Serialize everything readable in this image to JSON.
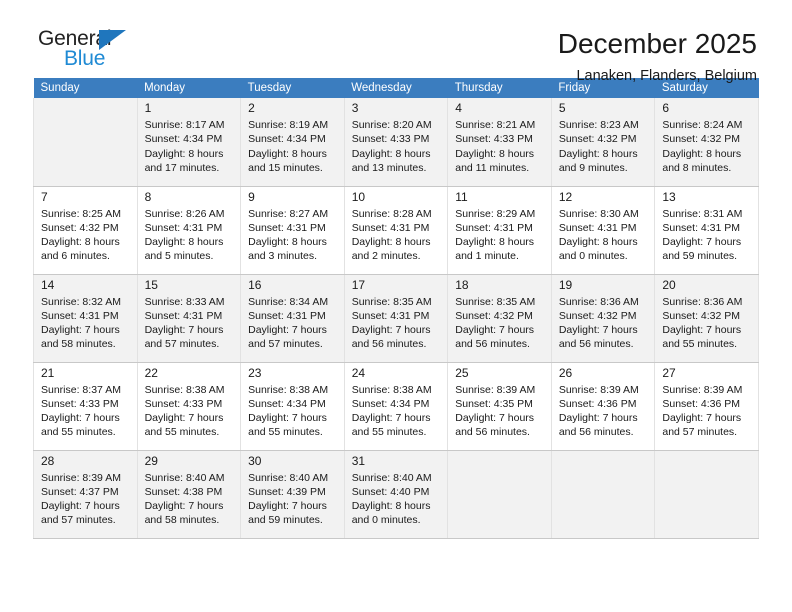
{
  "brand": {
    "name_top": "General",
    "name_bottom": "Blue",
    "triangle_color": "#1f76bd",
    "bottom_color": "#1f8ad4"
  },
  "header": {
    "month_title": "December 2025",
    "location": "Lanaken, Flanders, Belgium"
  },
  "colors": {
    "header_row_bg": "#3b7dbf",
    "header_row_text": "#ffffff",
    "shaded_row_bg": "#f2f2f2",
    "plain_row_bg": "#ffffff",
    "cell_border": "#c8c8c8"
  },
  "weekday_headers": [
    "Sunday",
    "Monday",
    "Tuesday",
    "Wednesday",
    "Thursday",
    "Friday",
    "Saturday"
  ],
  "weeks": [
    {
      "shaded": true,
      "days": [
        {
          "num": "",
          "sunrise": "",
          "sunset": "",
          "daylight1": "",
          "daylight2": "",
          "empty": true
        },
        {
          "num": "1",
          "sunrise": "Sunrise: 8:17 AM",
          "sunset": "Sunset: 4:34 PM",
          "daylight1": "Daylight: 8 hours",
          "daylight2": "and 17 minutes.",
          "empty": false
        },
        {
          "num": "2",
          "sunrise": "Sunrise: 8:19 AM",
          "sunset": "Sunset: 4:34 PM",
          "daylight1": "Daylight: 8 hours",
          "daylight2": "and 15 minutes.",
          "empty": false
        },
        {
          "num": "3",
          "sunrise": "Sunrise: 8:20 AM",
          "sunset": "Sunset: 4:33 PM",
          "daylight1": "Daylight: 8 hours",
          "daylight2": "and 13 minutes.",
          "empty": false
        },
        {
          "num": "4",
          "sunrise": "Sunrise: 8:21 AM",
          "sunset": "Sunset: 4:33 PM",
          "daylight1": "Daylight: 8 hours",
          "daylight2": "and 11 minutes.",
          "empty": false
        },
        {
          "num": "5",
          "sunrise": "Sunrise: 8:23 AM",
          "sunset": "Sunset: 4:32 PM",
          "daylight1": "Daylight: 8 hours",
          "daylight2": "and 9 minutes.",
          "empty": false
        },
        {
          "num": "6",
          "sunrise": "Sunrise: 8:24 AM",
          "sunset": "Sunset: 4:32 PM",
          "daylight1": "Daylight: 8 hours",
          "daylight2": "and 8 minutes.",
          "empty": false
        }
      ]
    },
    {
      "shaded": false,
      "days": [
        {
          "num": "7",
          "sunrise": "Sunrise: 8:25 AM",
          "sunset": "Sunset: 4:32 PM",
          "daylight1": "Daylight: 8 hours",
          "daylight2": "and 6 minutes.",
          "empty": false
        },
        {
          "num": "8",
          "sunrise": "Sunrise: 8:26 AM",
          "sunset": "Sunset: 4:31 PM",
          "daylight1": "Daylight: 8 hours",
          "daylight2": "and 5 minutes.",
          "empty": false
        },
        {
          "num": "9",
          "sunrise": "Sunrise: 8:27 AM",
          "sunset": "Sunset: 4:31 PM",
          "daylight1": "Daylight: 8 hours",
          "daylight2": "and 3 minutes.",
          "empty": false
        },
        {
          "num": "10",
          "sunrise": "Sunrise: 8:28 AM",
          "sunset": "Sunset: 4:31 PM",
          "daylight1": "Daylight: 8 hours",
          "daylight2": "and 2 minutes.",
          "empty": false
        },
        {
          "num": "11",
          "sunrise": "Sunrise: 8:29 AM",
          "sunset": "Sunset: 4:31 PM",
          "daylight1": "Daylight: 8 hours",
          "daylight2": "and 1 minute.",
          "empty": false
        },
        {
          "num": "12",
          "sunrise": "Sunrise: 8:30 AM",
          "sunset": "Sunset: 4:31 PM",
          "daylight1": "Daylight: 8 hours",
          "daylight2": "and 0 minutes.",
          "empty": false
        },
        {
          "num": "13",
          "sunrise": "Sunrise: 8:31 AM",
          "sunset": "Sunset: 4:31 PM",
          "daylight1": "Daylight: 7 hours",
          "daylight2": "and 59 minutes.",
          "empty": false
        }
      ]
    },
    {
      "shaded": true,
      "days": [
        {
          "num": "14",
          "sunrise": "Sunrise: 8:32 AM",
          "sunset": "Sunset: 4:31 PM",
          "daylight1": "Daylight: 7 hours",
          "daylight2": "and 58 minutes.",
          "empty": false
        },
        {
          "num": "15",
          "sunrise": "Sunrise: 8:33 AM",
          "sunset": "Sunset: 4:31 PM",
          "daylight1": "Daylight: 7 hours",
          "daylight2": "and 57 minutes.",
          "empty": false
        },
        {
          "num": "16",
          "sunrise": "Sunrise: 8:34 AM",
          "sunset": "Sunset: 4:31 PM",
          "daylight1": "Daylight: 7 hours",
          "daylight2": "and 57 minutes.",
          "empty": false
        },
        {
          "num": "17",
          "sunrise": "Sunrise: 8:35 AM",
          "sunset": "Sunset: 4:31 PM",
          "daylight1": "Daylight: 7 hours",
          "daylight2": "and 56 minutes.",
          "empty": false
        },
        {
          "num": "18",
          "sunrise": "Sunrise: 8:35 AM",
          "sunset": "Sunset: 4:32 PM",
          "daylight1": "Daylight: 7 hours",
          "daylight2": "and 56 minutes.",
          "empty": false
        },
        {
          "num": "19",
          "sunrise": "Sunrise: 8:36 AM",
          "sunset": "Sunset: 4:32 PM",
          "daylight1": "Daylight: 7 hours",
          "daylight2": "and 56 minutes.",
          "empty": false
        },
        {
          "num": "20",
          "sunrise": "Sunrise: 8:36 AM",
          "sunset": "Sunset: 4:32 PM",
          "daylight1": "Daylight: 7 hours",
          "daylight2": "and 55 minutes.",
          "empty": false
        }
      ]
    },
    {
      "shaded": false,
      "days": [
        {
          "num": "21",
          "sunrise": "Sunrise: 8:37 AM",
          "sunset": "Sunset: 4:33 PM",
          "daylight1": "Daylight: 7 hours",
          "daylight2": "and 55 minutes.",
          "empty": false
        },
        {
          "num": "22",
          "sunrise": "Sunrise: 8:38 AM",
          "sunset": "Sunset: 4:33 PM",
          "daylight1": "Daylight: 7 hours",
          "daylight2": "and 55 minutes.",
          "empty": false
        },
        {
          "num": "23",
          "sunrise": "Sunrise: 8:38 AM",
          "sunset": "Sunset: 4:34 PM",
          "daylight1": "Daylight: 7 hours",
          "daylight2": "and 55 minutes.",
          "empty": false
        },
        {
          "num": "24",
          "sunrise": "Sunrise: 8:38 AM",
          "sunset": "Sunset: 4:34 PM",
          "daylight1": "Daylight: 7 hours",
          "daylight2": "and 55 minutes.",
          "empty": false
        },
        {
          "num": "25",
          "sunrise": "Sunrise: 8:39 AM",
          "sunset": "Sunset: 4:35 PM",
          "daylight1": "Daylight: 7 hours",
          "daylight2": "and 56 minutes.",
          "empty": false
        },
        {
          "num": "26",
          "sunrise": "Sunrise: 8:39 AM",
          "sunset": "Sunset: 4:36 PM",
          "daylight1": "Daylight: 7 hours",
          "daylight2": "and 56 minutes.",
          "empty": false
        },
        {
          "num": "27",
          "sunrise": "Sunrise: 8:39 AM",
          "sunset": "Sunset: 4:36 PM",
          "daylight1": "Daylight: 7 hours",
          "daylight2": "and 57 minutes.",
          "empty": false
        }
      ]
    },
    {
      "shaded": true,
      "days": [
        {
          "num": "28",
          "sunrise": "Sunrise: 8:39 AM",
          "sunset": "Sunset: 4:37 PM",
          "daylight1": "Daylight: 7 hours",
          "daylight2": "and 57 minutes.",
          "empty": false
        },
        {
          "num": "29",
          "sunrise": "Sunrise: 8:40 AM",
          "sunset": "Sunset: 4:38 PM",
          "daylight1": "Daylight: 7 hours",
          "daylight2": "and 58 minutes.",
          "empty": false
        },
        {
          "num": "30",
          "sunrise": "Sunrise: 8:40 AM",
          "sunset": "Sunset: 4:39 PM",
          "daylight1": "Daylight: 7 hours",
          "daylight2": "and 59 minutes.",
          "empty": false
        },
        {
          "num": "31",
          "sunrise": "Sunrise: 8:40 AM",
          "sunset": "Sunset: 4:40 PM",
          "daylight1": "Daylight: 8 hours",
          "daylight2": "and 0 minutes.",
          "empty": false
        },
        {
          "num": "",
          "sunrise": "",
          "sunset": "",
          "daylight1": "",
          "daylight2": "",
          "empty": true
        },
        {
          "num": "",
          "sunrise": "",
          "sunset": "",
          "daylight1": "",
          "daylight2": "",
          "empty": true
        },
        {
          "num": "",
          "sunrise": "",
          "sunset": "",
          "daylight1": "",
          "daylight2": "",
          "empty": true
        }
      ]
    }
  ]
}
